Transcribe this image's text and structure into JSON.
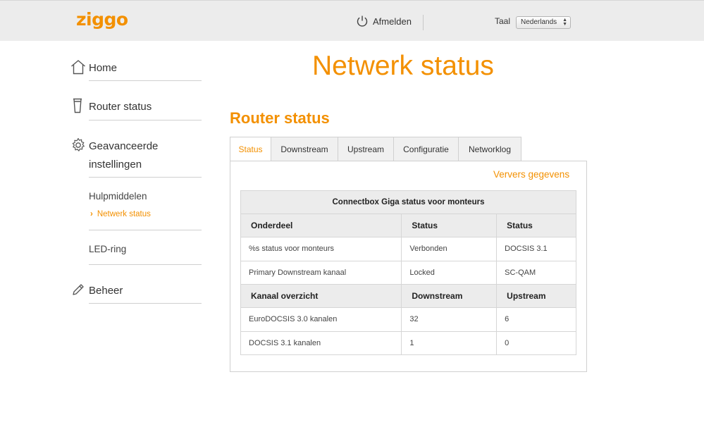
{
  "header": {
    "logo": "ziggo",
    "logout_label": "Afmelden",
    "language_label": "Taal",
    "language_value": "Nederlands"
  },
  "sidebar": {
    "items": [
      {
        "label": "Home",
        "icon": "home-icon"
      },
      {
        "label": "Router status",
        "icon": "router-icon"
      },
      {
        "label_line1": "Geavanceerde",
        "label_line2": "instellingen",
        "icon": "gear-icon"
      },
      {
        "label": "Beheer",
        "icon": "pencil-icon"
      }
    ],
    "subitems": {
      "hulpmiddelen": "Hulpmiddelen",
      "netwerk_status": "Netwerk status",
      "led_ring": "LED-ring"
    }
  },
  "main": {
    "page_title": "Netwerk status",
    "section_title": "Router status",
    "tabs": [
      "Status",
      "Downstream",
      "Upstream",
      "Configuratie",
      "Networklog"
    ],
    "refresh_label": "Ververs gegevens",
    "table": {
      "caption": "Connectbox Giga status voor monteurs",
      "header1": [
        "Onderdeel",
        "Status",
        "Status"
      ],
      "rows1": [
        [
          "%s status voor monteurs",
          "Verbonden",
          "DOCSIS 3.1"
        ],
        [
          "Primary Downstream kanaal",
          "Locked",
          "SC-QAM"
        ]
      ],
      "header2": [
        "Kanaal overzicht",
        "Downstream",
        "Upstream"
      ],
      "rows2": [
        [
          "EuroDOCSIS 3.0 kanalen",
          "32",
          "6"
        ],
        [
          "DOCSIS 3.1 kanalen",
          "1",
          "0"
        ]
      ]
    }
  },
  "colors": {
    "accent": "#f39000",
    "header_bg": "#ececec"
  }
}
